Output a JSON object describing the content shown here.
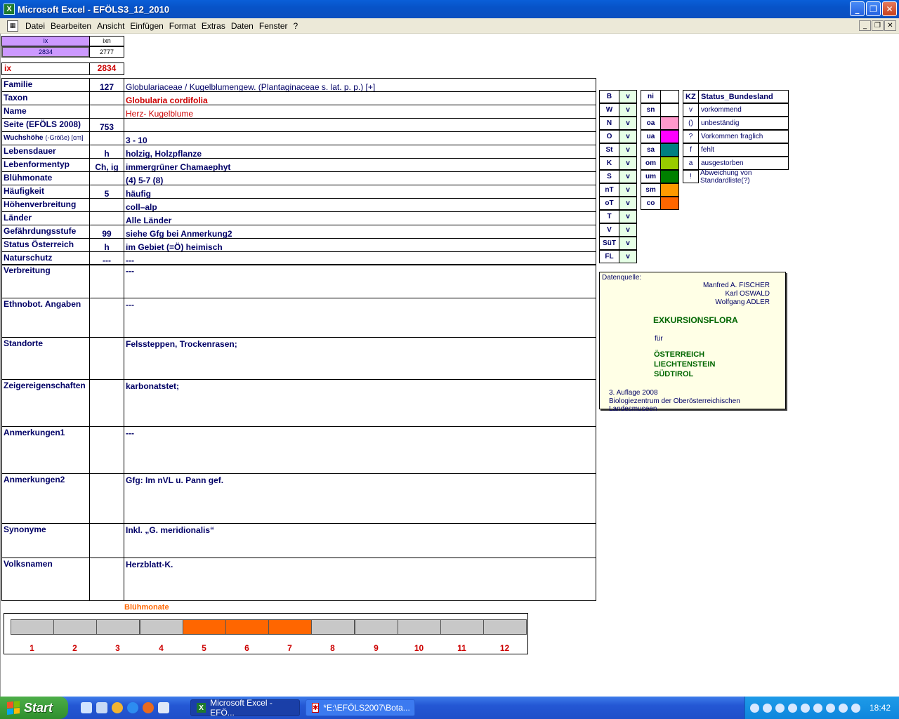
{
  "window": {
    "title": "Microsoft Excel - EFÖLS3_12_2010",
    "app_icon": "excel-icon"
  },
  "menu": [
    "Datei",
    "Bearbeiten",
    "Ansicht",
    "Einfügen",
    "Format",
    "Extras",
    "Daten",
    "Fenster",
    "?"
  ],
  "index_box": {
    "h1": "ix",
    "h2": "ixn",
    "v1": "2834",
    "v2": "2777",
    "ix_label": "ix",
    "ix_value": "2834"
  },
  "rows": [
    {
      "label": "Familie",
      "mid": "127",
      "value": "Globulariaceae  /  Kugelblumengew. (Plantaginaceae s. lat. p. p.) [+]"
    },
    {
      "label": "Taxon",
      "mid": "",
      "value": "Globularia cordifolia"
    },
    {
      "label": "Name",
      "mid": "",
      "value": "Herz- Kugelblume"
    },
    {
      "label": "Seite (EFÖLS 2008)",
      "mid": "753",
      "value": ""
    },
    {
      "label": "Wuchshöhe",
      "label_small": "(-Größe) [cm]",
      "mid": "",
      "value": "3 - 10"
    },
    {
      "label": "Lebensdauer",
      "mid": "h",
      "value": "holzig, Holzpflanze"
    },
    {
      "label": "Lebenformentyp",
      "mid": "Ch, ig",
      "value": "immergrüner Chamaephyt"
    },
    {
      "label": "Blühmonate",
      "mid": "",
      "value": "(4) 5-7 (8)"
    },
    {
      "label": "Häufigkeit",
      "mid": "5",
      "value": "häufig"
    },
    {
      "label": "Höhenverbreitung",
      "mid": "",
      "value": "coll–alp"
    },
    {
      "label": "Länder",
      "mid": "",
      "value": "Alle Länder"
    },
    {
      "label": "Gefährdungsstufe",
      "mid": "99",
      "value": "siehe Gfg bei Anmerkung2"
    },
    {
      "label": "Status Österreich",
      "mid": "h",
      "value": "im Gebiet (=Ö) heimisch"
    },
    {
      "label": "Naturschutz",
      "mid": "---",
      "value": "---"
    }
  ],
  "big_rows": [
    {
      "label": "Verbreitung",
      "value": "---"
    },
    {
      "label": "Ethnobot. Angaben",
      "value": "---"
    },
    {
      "label": "Standorte",
      "value": "Felssteppen, Trockenrasen;"
    },
    {
      "label": "Zeigereigenschaften",
      "value": "karbonatstet;"
    },
    {
      "label": "Anmerkungen1",
      "value": "---"
    },
    {
      "label": "Anmerkungen2",
      "value": "Gfg: Im nVL u. Pann gef."
    },
    {
      "label": "Synonyme",
      "value": "Inkl. „G. meridionalis“"
    },
    {
      "label": "Volksnamen",
      "value": "Herzblatt-K."
    }
  ],
  "states": [
    {
      "code": "B",
      "v": "v"
    },
    {
      "code": "W",
      "v": "v"
    },
    {
      "code": "N",
      "v": "v"
    },
    {
      "code": "O",
      "v": "v"
    },
    {
      "code": "St",
      "v": "v"
    },
    {
      "code": "K",
      "v": "v"
    },
    {
      "code": "S",
      "v": "v"
    },
    {
      "code": "nT",
      "v": "v"
    },
    {
      "code": "oT",
      "v": "v"
    },
    {
      "code": "T",
      "v": "v"
    },
    {
      "code": "V",
      "v": "v"
    },
    {
      "code": "SüT",
      "v": "v"
    },
    {
      "code": "FL",
      "v": "v"
    }
  ],
  "altitude": [
    {
      "code": "ni",
      "color": "#ffffff"
    },
    {
      "code": "sn",
      "color": "#ffffff"
    },
    {
      "code": "oa",
      "color": "#ff99cc"
    },
    {
      "code": "ua",
      "color": "#ff00ff"
    },
    {
      "code": "sa",
      "color": "#008080"
    },
    {
      "code": "om",
      "color": "#99cc00"
    },
    {
      "code": "um",
      "color": "#008000"
    },
    {
      "code": "sm",
      "color": "#ff9900"
    },
    {
      "code": "co",
      "color": "#ff6600"
    }
  ],
  "status_legend": {
    "header_kz": "KZ",
    "header_label": "Status_Bundesland",
    "items": [
      {
        "kz": "v",
        "label": "vorkommend"
      },
      {
        "kz": "()",
        "label": "unbeständig"
      },
      {
        "kz": "?",
        "label": "Vorkommen fraglich"
      },
      {
        "kz": "f",
        "label": "fehlt"
      },
      {
        "kz": "a",
        "label": "ausgestorben"
      },
      {
        "kz": "!",
        "label": "Abweichung von Standardliste(?)"
      }
    ]
  },
  "source": {
    "label": "Datenquelle:",
    "authors": [
      "Manfred A. FISCHER",
      "Karl OSWALD",
      "Wolfgang ADLER"
    ],
    "title": "EXKURSIONSFLORA",
    "fuer": "für",
    "countries": [
      "ÖSTERREICH",
      "LIECHTENSTEIN",
      "SÜDTIROL"
    ],
    "edition": "3. Auflage 2008",
    "publisher": "Biologiezentrum der Oberösterreichischen Landesmuseen"
  },
  "bloom": {
    "title": "Blühmonate",
    "months": [
      "1",
      "2",
      "3",
      "4",
      "5",
      "6",
      "7",
      "8",
      "9",
      "10",
      "11",
      "12"
    ],
    "active": [
      false,
      false,
      false,
      false,
      true,
      true,
      true,
      false,
      false,
      false,
      false,
      false
    ],
    "active_color": "#ff6600",
    "inactive_color": "#c8c8c8"
  },
  "taskbar": {
    "start": "Start",
    "tasks": [
      "Microsoft Excel - EFÖ...",
      "*E:\\EFÖLS2007\\Bota..."
    ],
    "clock": "18:42"
  }
}
